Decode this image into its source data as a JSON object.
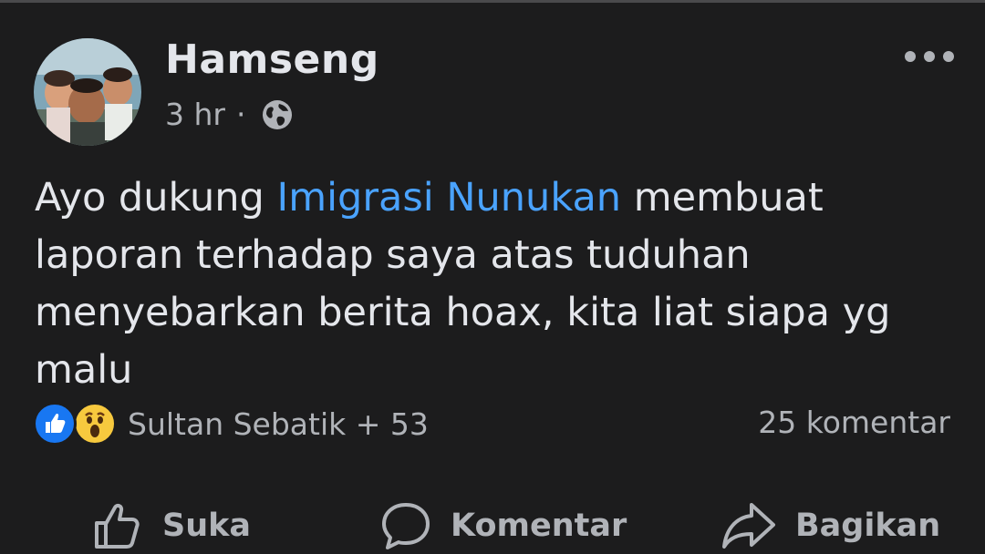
{
  "post": {
    "author": "Hamseng",
    "time": "3 hr",
    "separator": "·",
    "privacy_icon": "globe-icon",
    "more_icon": "more-options-icon",
    "text_before": "Ayo dukung ",
    "mention": "Imigrasi Nunukan",
    "text_after": " membuat laporan terhadap saya atas tuduhan menyebarkan berita hoax, kita liat siapa yg malu",
    "mention_color": "#4aa3ff"
  },
  "reactions": {
    "icons": [
      "like-icon",
      "wow-icon"
    ],
    "summary": "Sultan Sebatik + 53",
    "comments": "25 komentar"
  },
  "actions": {
    "like": "Suka",
    "comment": "Komentar",
    "share": "Bagikan"
  },
  "colors": {
    "background": "#1c1c1d",
    "primary_text": "#e4e6eb",
    "secondary_text": "#b0b3b8",
    "like_blue": "#1877f2",
    "wow_yellow": "#f7c93e"
  }
}
